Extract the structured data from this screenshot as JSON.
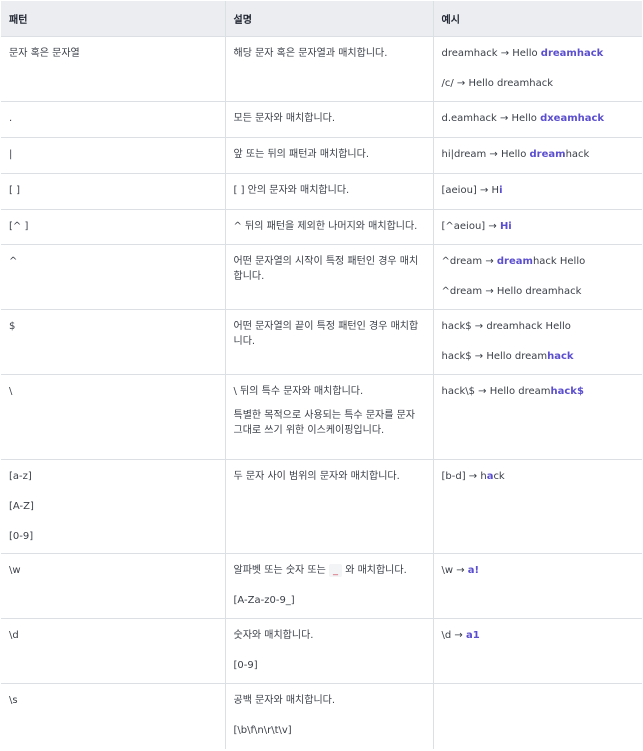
{
  "headers": [
    "패턴",
    "설명",
    "예시"
  ],
  "rows": [
    {
      "pattern": [
        "문자 혹은 문자열"
      ],
      "desc": [
        "해당 문자 혹은 문자열과 매치합니다."
      ],
      "examples": [
        [
          {
            "t": "dreamhack → Hello "
          },
          {
            "t": "dreamhack",
            "hl": true
          }
        ],
        [
          {
            "t": "/c/ → Hello dreamhack"
          }
        ]
      ]
    },
    {
      "pattern": [
        "."
      ],
      "desc": [
        "모든 문자와 매치합니다."
      ],
      "examples": [
        [
          {
            "t": "d.eamhack → Hello "
          },
          {
            "t": "dxeamhack",
            "hl": true
          }
        ]
      ]
    },
    {
      "pattern": [
        "|"
      ],
      "desc": [
        "앞 또는 뒤의 패턴과 매치합니다."
      ],
      "examples": [
        [
          {
            "t": "hi|dream → Hello "
          },
          {
            "t": "dream",
            "hl": true
          },
          {
            "t": "hack"
          }
        ]
      ]
    },
    {
      "pattern": [
        "[ ]"
      ],
      "desc": [
        "[ ] 안의 문자와 매치합니다."
      ],
      "examples": [
        [
          {
            "t": "[aeiou] → H"
          },
          {
            "t": "i",
            "hl": true
          }
        ]
      ]
    },
    {
      "pattern": [
        "[^ ]"
      ],
      "desc": [
        "^ 뒤의 패턴을 제외한 나머지와 매치합니다."
      ],
      "examples": [
        [
          {
            "t": "[^aeiou] → "
          },
          {
            "t": "Hi",
            "hl": true
          }
        ]
      ]
    },
    {
      "pattern": [
        "^"
      ],
      "desc": [
        "어떤 문자열의 시작이 특정 패턴인 경우 매치합니다."
      ],
      "examples": [
        [
          {
            "t": "^dream → "
          },
          {
            "t": "dream",
            "hl": true
          },
          {
            "t": "hack Hello"
          }
        ],
        [
          {
            "t": "^dream → Hello dreamhack"
          }
        ]
      ]
    },
    {
      "pattern": [
        "$"
      ],
      "desc": [
        "어떤 문자열의 끝이 특정 패턴인 경우 매치합니다."
      ],
      "examples": [
        [
          {
            "t": "hack$ → dreamhack Hello"
          }
        ],
        [
          {
            "t": "hack$ → Hello dream"
          },
          {
            "t": "hack",
            "hl": true
          }
        ]
      ]
    },
    {
      "pattern": [
        "\\"
      ],
      "desc": [
        "\\ 뒤의 특수 문자와 매치합니다.",
        "특별한 목적으로 사용되는 특수 문자를 문자 그대로 쓰기 위한 이스케이핑입니다."
      ],
      "examples": [
        [
          {
            "t": "hack\\$ → Hello dream"
          },
          {
            "t": "hack$",
            "hl": true
          }
        ]
      ]
    },
    {
      "pattern": [
        "[a-z]",
        "[A-Z]",
        "[0-9]"
      ],
      "desc": [
        "두 문자 사이 범위의 문자와 매치합니다."
      ],
      "examples": [
        [
          {
            "t": "[b-d] → "
          },
          {
            "t": "h"
          },
          {
            "t": "a",
            "hl": true
          },
          {
            "t": "ck"
          }
        ]
      ]
    },
    {
      "pattern": [
        "\\w"
      ],
      "desc_rich": [
        [
          {
            "t": "알파벳 또는 숫자 또는 "
          },
          {
            "t": "_",
            "code": true
          },
          {
            "t": " 와 매치합니다."
          }
        ],
        [
          {
            "t": "[A-Za-z0-9_]"
          }
        ]
      ],
      "examples": [
        [
          {
            "t": "\\w → "
          },
          {
            "t": "a!",
            "hl": true
          }
        ]
      ]
    },
    {
      "pattern": [
        "\\d"
      ],
      "desc": [
        "숫자와 매치합니다.",
        "[0-9]"
      ],
      "examples": [
        [
          {
            "t": "\\d → "
          },
          {
            "t": "a1",
            "hl": true
          }
        ]
      ]
    },
    {
      "pattern": [
        "\\s"
      ],
      "desc": [
        "공백 문자와 매치합니다.",
        "[\\b\\f\\n\\r\\t\\v]"
      ],
      "examples": []
    }
  ]
}
